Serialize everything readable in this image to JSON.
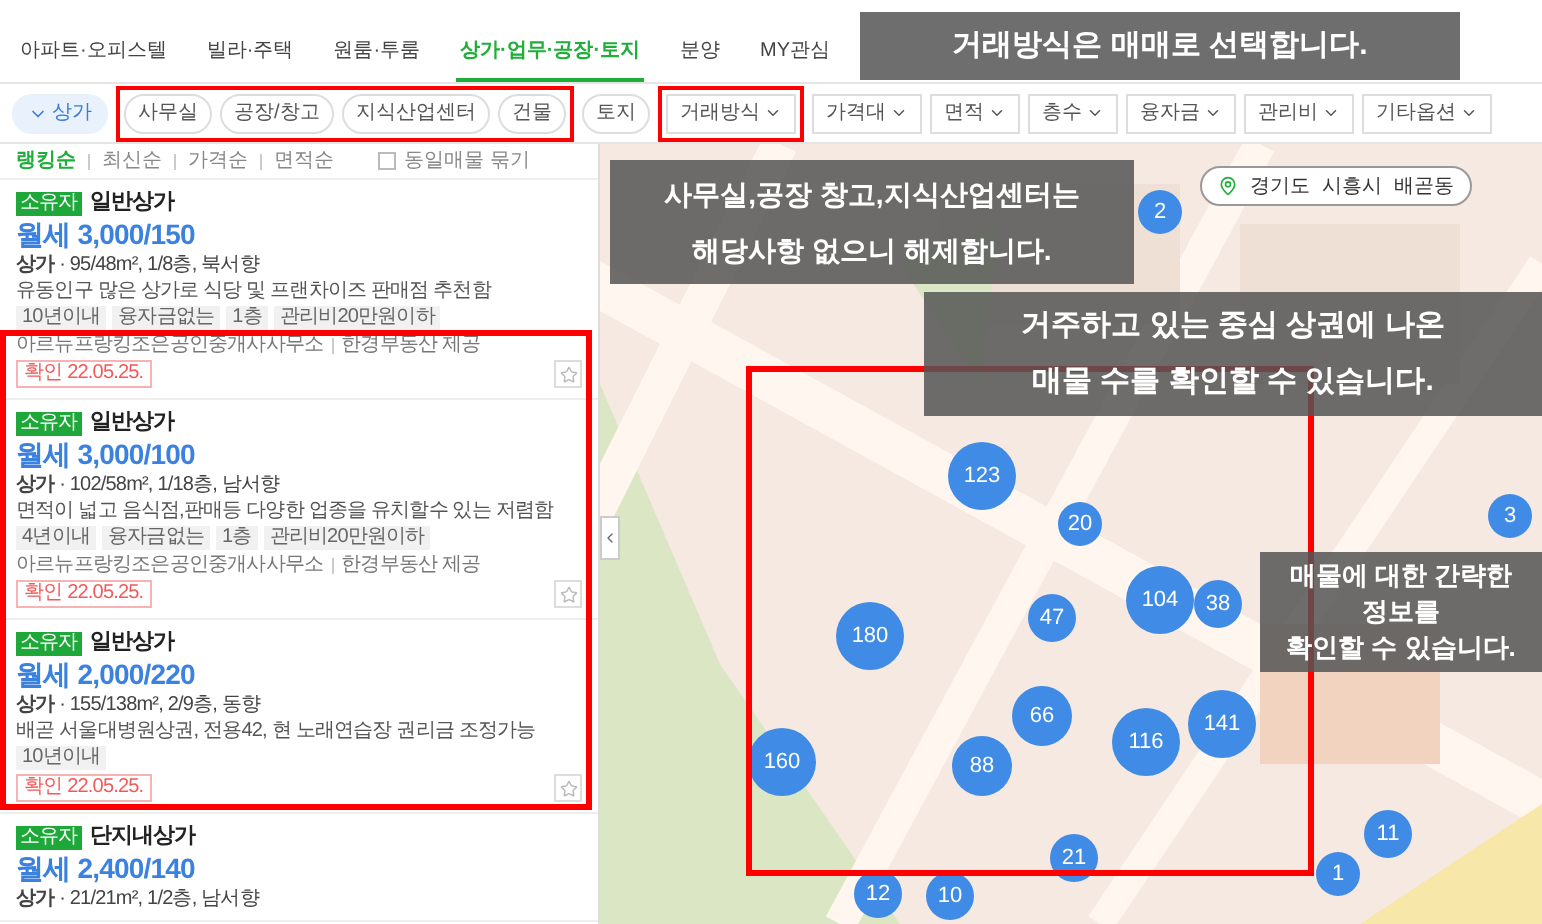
{
  "nav_tabs": [
    {
      "label": "아파트·오피스텔",
      "selected": false
    },
    {
      "label": "빌라·주택",
      "selected": false
    },
    {
      "label": "원룸·투룸",
      "selected": false
    },
    {
      "label": "상가·업무·공장·토지",
      "selected": true
    },
    {
      "label": "분양",
      "selected": false
    },
    {
      "label": "MY관심",
      "selected": false
    }
  ],
  "filters": {
    "category": "상가",
    "chips": [
      "사무실",
      "공장/창고",
      "지식산업센터",
      "건물",
      "토지"
    ],
    "dropdowns": [
      "거래방식",
      "가격대",
      "면적",
      "층수",
      "융자금",
      "관리비",
      "기타옵션"
    ]
  },
  "sort": {
    "options": [
      {
        "label": "랭킹순",
        "selected": true
      },
      {
        "label": "최신순",
        "selected": false
      },
      {
        "label": "가격순",
        "selected": false
      },
      {
        "label": "면적순",
        "selected": false
      }
    ],
    "group_checkbox": {
      "label": "동일매물 묶기",
      "checked": false
    }
  },
  "listings": [
    {
      "badge": "소유자",
      "title": "일반상가",
      "price": "월세 3,000/150",
      "spec": "**상가** · 95/48m², 1/8층, 북서향",
      "description": "유동인구 많은 상가로 식당 및 프랜차이즈 판매점 추천함",
      "tags": [
        "10년이내",
        "융자금없는",
        "1층",
        "관리비20만원이하"
      ],
      "agent": "아르뉴프랑킹조은공인중개사사무소",
      "source": "한경부동산 제공",
      "confirmed": "확인 22.05.25."
    },
    {
      "badge": "소유자",
      "title": "일반상가",
      "price": "월세 3,000/100",
      "spec": "**상가** · 102/58m², 1/18층, 남서향",
      "description": "면적이 넓고 음식점,판매등 다양한 업종을 유치할수 있는 저렴함",
      "tags": [
        "4년이내",
        "융자금없는",
        "1층",
        "관리비20만원이하"
      ],
      "agent": "아르뉴프랑킹조은공인중개사사무소",
      "source": "한경부동산 제공",
      "confirmed": "확인 22.05.25."
    },
    {
      "badge": "소유자",
      "title": "일반상가",
      "price": "월세 2,000/220",
      "spec": "**상가** · 155/138m², 2/9층, 동향",
      "description": "배곧 서울대병원상권, 전용42, 현 노래연습장 권리금 조정가능",
      "tags": [
        "10년이내"
      ],
      "confirmed": "확인 22.05.25."
    },
    {
      "badge": "소유자",
      "title": "단지내상가",
      "price": "월세 2,400/140",
      "spec": "**상가** · 21/21m², 1/2층, 남서향"
    }
  ],
  "map": {
    "breadcrumb": [
      "경기도",
      "시흥시",
      "배곧동"
    ],
    "clusters": [
      {
        "count": "2"
      },
      {
        "count": "123"
      },
      {
        "count": "20"
      },
      {
        "count": "3"
      },
      {
        "count": "180"
      },
      {
        "count": "47"
      },
      {
        "count": "104"
      },
      {
        "count": "38"
      },
      {
        "count": "66"
      },
      {
        "count": "116"
      },
      {
        "count": "141"
      },
      {
        "count": "160"
      },
      {
        "count": "88"
      },
      {
        "count": "21"
      },
      {
        "count": "12"
      },
      {
        "count": "10"
      },
      {
        "count": "1"
      },
      {
        "count": "11"
      }
    ]
  },
  "tutorial_notes": [
    {
      "lines": [
        "거래방식은 매매로 선택합니다."
      ]
    },
    {
      "lines": [
        "사무실,공장 창고,지식산업센터는",
        "해당사항 없으니 해제합니다."
      ]
    },
    {
      "lines": [
        "거주하고 있는 중심 상권에 나온",
        "매물 수를 확인할 수 있습니다."
      ]
    },
    {
      "lines": [
        "매물에 대한 간략한 정보를",
        "확인할 수 있습니다."
      ]
    }
  ]
}
